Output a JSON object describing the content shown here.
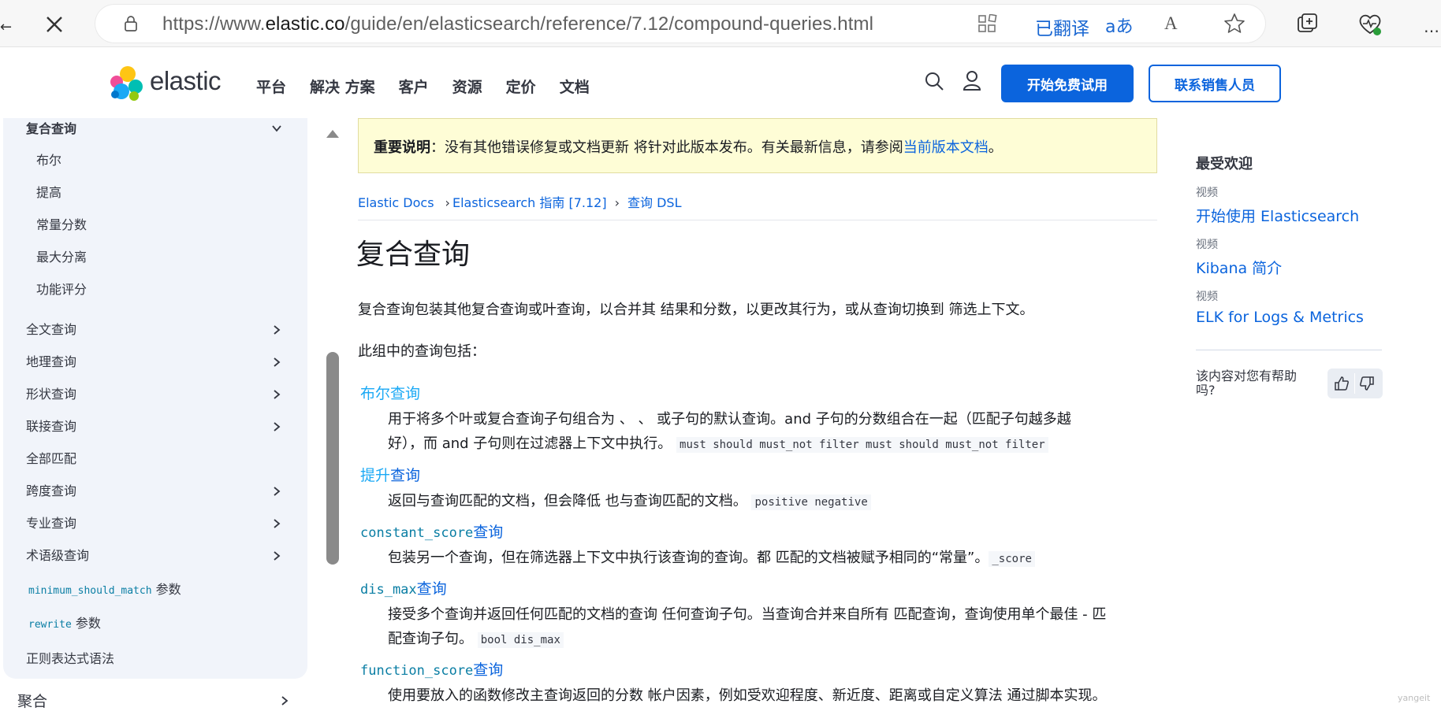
{
  "browser": {
    "url_prefix": "https://www.",
    "url_domain": "elastic.co",
    "url_path": "/guide/en/elasticsearch/reference/7.12/compound-queries.html",
    "translated_label": "已翻译",
    "translate_icon_glyph": "aあ",
    "read_aloud_glyph": "A"
  },
  "header": {
    "logo_text": "elastic",
    "nav": [
      "平台",
      "解决 方案",
      "客户",
      "资源",
      "定价",
      "文档"
    ],
    "trial_button": "开始免费试用",
    "sales_button": "联系销售人员"
  },
  "sidebar": {
    "section_title": "复合查询",
    "sub_items": [
      "布尔",
      "提高",
      "常量分数",
      "最大分离",
      "功能评分"
    ],
    "items": [
      {
        "label": "全文查询",
        "expandable": true
      },
      {
        "label": "地理查询",
        "expandable": true
      },
      {
        "label": "形状查询",
        "expandable": true
      },
      {
        "label": "联接查询",
        "expandable": true
      },
      {
        "label": "全部匹配",
        "expandable": false
      },
      {
        "label": "跨度查询",
        "expandable": true
      },
      {
        "label": "专业查询",
        "expandable": true
      },
      {
        "label": "术语级查询",
        "expandable": true
      }
    ],
    "param1_code": "minimum_should_match",
    "param1_text": "参数",
    "param2_code": "rewrite",
    "param2_text": "参数",
    "regex_item": "正则表达式语法",
    "below_item": "聚合"
  },
  "notice": {
    "bold": "重要说明",
    "text": "：没有其他错误修复或文档更新 将针对此版本发布。有关最新信息，请参阅",
    "link": "当前版本文档",
    "end": "。"
  },
  "breadcrumbs": [
    "Elastic Docs",
    "Elasticsearch 指南 [7.12]",
    "查询 DSL"
  ],
  "breadcrumb_sep": "›",
  "page_title": "复合查询",
  "intro": "复合查询包装其他复合查询或叶查询，以合并其 结果和分数，以更改其行为，或从查询切换到 筛选上下文。",
  "intro2": "此组中的查询包括：",
  "queries": [
    {
      "term_a": "布尔查询",
      "desc1": "用于将多个叶或复合查询子句组合为 、 、 或子句的默认查询。and 子句的分数组合在一起（匹配子句越多越",
      "desc2": "好），而 and 子句则在过滤器上下文中执行。",
      "code": "must should must_not filter must should must_not filter"
    },
    {
      "term_a": "提升",
      "term_b": "查询",
      "desc1": "返回与查询匹配的文档，但会降低 也与查询匹配的文档。",
      "code": "positive negative"
    },
    {
      "term_code": "constant_score",
      "term_b": "查询",
      "desc1": "包装另一个查询，但在筛选器上下文中执行该查询的查询。都 匹配的文档被赋予相同的“常量”。",
      "code": "_score"
    },
    {
      "term_code": "dis_max",
      "term_b": "查询",
      "desc1": "接受多个查询并返回任何匹配的文档的查询 任何查询子句。当查询合并来自所有 匹配查询，查询使用单个最佳 - 匹",
      "desc2": "配查询子句。",
      "code": "bool dis_max"
    },
    {
      "term_code": "function_score",
      "term_b": "查询",
      "desc1": "使用要放入的函数修改主查询返回的分数 帐户因素，例如受欢迎程度、新近度、距离或自定义算法 通过脚本实现。"
    }
  ],
  "rail": {
    "title": "最受欢迎",
    "items": [
      {
        "kind": "视频",
        "link": "开始使用 Elasticsearch"
      },
      {
        "kind": "视频",
        "link": "Kibana 简介"
      },
      {
        "kind": "视频",
        "link": "ELK for Logs & Metrics"
      }
    ],
    "helpful": "该内容对您有帮助吗?"
  },
  "watermark": "yangeit"
}
